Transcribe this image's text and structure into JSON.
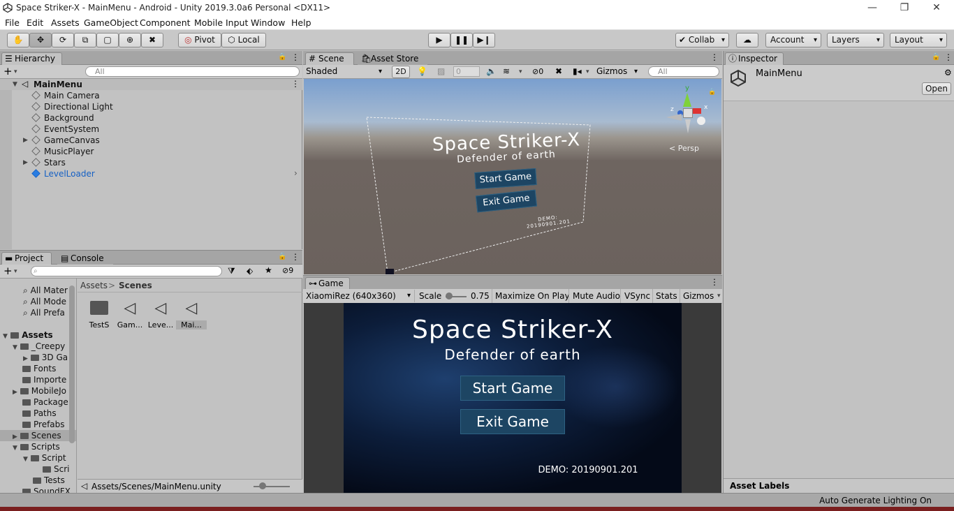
{
  "window": {
    "title": "Space Striker-X - MainMenu - Android - Unity 2019.3.0a6 Personal <DX11>",
    "minimize": "—",
    "restore": "❐",
    "close": "✕"
  },
  "menu": [
    "File",
    "Edit",
    "Assets",
    "GameObject",
    "Component",
    "Mobile Input",
    "Window",
    "Help"
  ],
  "toolbar": {
    "pivot": "Pivot",
    "local": "Local",
    "collab": "Collab",
    "account": "Account",
    "layers": "Layers",
    "layout": "Layout"
  },
  "hierarchy": {
    "tab": "Hierarchy",
    "search": "All",
    "scene": "MainMenu",
    "items": [
      "Main Camera",
      "Directional Light",
      "Background",
      "EventSystem",
      "GameCanvas",
      "MusicPlayer",
      "Stars",
      "LevelLoader"
    ]
  },
  "scene": {
    "tab": "Scene",
    "tab2": "Asset Store",
    "shading": "Shaded",
    "mode2d": "2D",
    "fx": "0",
    "hidden": "0",
    "gizmos": "Gizmos",
    "search": "All",
    "persp": "< Persp",
    "axis_y": "y",
    "axis_x": "x",
    "axis_z": "z"
  },
  "game": {
    "tab": "Game",
    "resolution": "XiaomiRez (640x360)",
    "scale_label": "Scale",
    "scale": "0.75",
    "maximize": "Maximize On Play",
    "mute": "Mute Audio",
    "vsync": "VSync",
    "stats": "Stats",
    "gizmos": "Gizmos",
    "title": "Space Striker-X",
    "subtitle": "Defender of earth",
    "start": "Start Game",
    "exit": "Exit Game",
    "demo": "DEMO: 20190901.201"
  },
  "project": {
    "tab": "Project",
    "tab2": "Console",
    "count": "9",
    "favorites": [
      "All Mater",
      "All Mode",
      "All Prefa"
    ],
    "assets_root": "Assets",
    "tree": [
      "_Creepy",
      "3D Ga",
      "Fonts",
      "Importe",
      "MobileJo",
      "Package",
      "Paths",
      "Prefabs",
      "Scenes",
      "Scripts",
      "Script",
      "Scri",
      "Tests",
      "SoundFX"
    ],
    "breadcrumb_root": "Assets",
    "breadcrumb_sep": ">",
    "breadcrumb_current": "Scenes",
    "files": [
      "TestS",
      "Gam...",
      "Leve...",
      "Mai..."
    ],
    "path": "Assets/Scenes/MainMenu.unity"
  },
  "inspector": {
    "tab": "Inspector",
    "object": "MainMenu",
    "open": "Open",
    "asset_labels": "Asset Labels"
  },
  "status": {
    "text": "Auto Generate Lighting On"
  }
}
